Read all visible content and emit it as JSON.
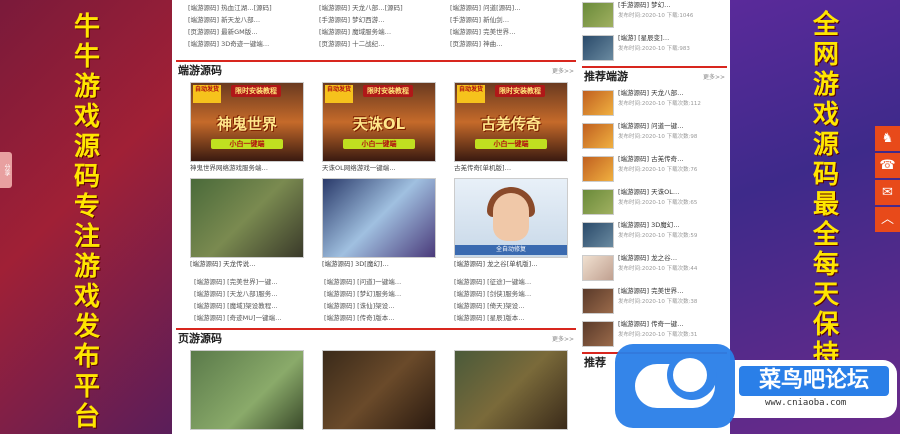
{
  "left_banner": {
    "text": [
      "牛",
      "牛",
      "游",
      "戏",
      "源",
      "码",
      "专",
      "注",
      "游",
      "戏",
      "发",
      "布",
      "平",
      "台"
    ]
  },
  "right_banner": {
    "text": [
      "全",
      "网",
      "游",
      "戏",
      "源",
      "码",
      "最",
      "全",
      "每",
      "天",
      "保",
      "持"
    ]
  },
  "side_tab": {
    "label": "分享"
  },
  "top_news": {
    "col1": [
      "[端游源码] 热血江湖…[源码]",
      "[端游源码] 新天龙八部…",
      "[页游源码] 最新GM版…",
      "[端游源码] 3D奇迹一键端…"
    ],
    "col2": [
      "[端游源码] 天龙八部…[源码]",
      "[手游源码] 梦幻西游…",
      "[端游源码] 魔域服务端…",
      "[页游源码] 十二战纪…"
    ],
    "col3": [
      "[端游源码] 问道[源码]…",
      "[手游源码] 新仙剑…",
      "[端游源码] 完美世界…",
      "[页游源码] 神曲…"
    ]
  },
  "section_duanyou": {
    "title": "端游源码",
    "more": "更多>>",
    "promo_top": "限时安装教程",
    "promo_badge": "自动发货",
    "cards": [
      {
        "type": "promo",
        "big": "神鬼世界",
        "sub": "小白一键端",
        "caption": "神鬼世界网络游戏服务端…"
      },
      {
        "type": "promo",
        "big": "天诛OL",
        "sub": "小白一键端",
        "caption": "天诛OL网络游戏一键端…"
      },
      {
        "type": "promo",
        "big": "古羌传奇",
        "sub": "小白一键端",
        "caption": "古羌传奇[单机版]…"
      },
      {
        "type": "game1",
        "caption": "[端游源码] 天龙传说…"
      },
      {
        "type": "game2",
        "caption": "[端游源码] 3D[魔幻]…"
      },
      {
        "type": "game3",
        "bar": "全自动修复",
        "caption": "[端游源码] 龙之谷[单机版]…"
      }
    ],
    "list": {
      "col1": [
        "[端游源码] [完美世界]一键…",
        "[端游源码] [天龙八部]服务…",
        "[端游源码] [魔域]架设教程…",
        "[端游源码] [奇迹MU]一键端…"
      ],
      "col2": [
        "[端游源码] [问道]一键端…",
        "[端游源码] [梦幻]服务端…",
        "[端游源码] [诛仙]架设…",
        "[端游源码] [传奇]版本…"
      ],
      "col3": [
        "[端游源码] [征途]一键端…",
        "[端游源码] [剑侠]服务端…",
        "[端游源码] [倚天]架设…",
        "[端游源码] [星辰]版本…"
      ]
    }
  },
  "section_yeyou": {
    "title": "页游源码",
    "more": "更多>>",
    "cards": [
      {
        "type": "game4"
      },
      {
        "type": "game5"
      },
      {
        "type": "game6"
      }
    ]
  },
  "sidebar_top": [
    {
      "name": "[手游源码] 梦幻…",
      "meta": "发布时间:2020-10 下载:1046"
    },
    {
      "name": "[端游] [星辰变]…",
      "meta": "发布时间:2020-10 下载:983"
    }
  ],
  "sidebar_recommend": {
    "title": "推荐端游",
    "more": "更多>>",
    "items": [
      {
        "name": "[端游源码] 天龙八部…",
        "meta": "发布时间:2020-10 下载次数:112"
      },
      {
        "name": "[端游源码] 问道一键…",
        "meta": "发布时间:2020-10 下载次数:98"
      },
      {
        "name": "[端游源码] 古羌传奇…",
        "meta": "发布时间:2020-10 下载次数:76"
      },
      {
        "name": "[端游源码] 天诛OL…",
        "meta": "发布时间:2020-10 下载次数:65"
      },
      {
        "name": "[端游源码] 3D魔幻…",
        "meta": "发布时间:2020-10 下载次数:59"
      },
      {
        "name": "[端游源码] 龙之谷…",
        "meta": "发布时间:2020-10 下载次数:44"
      },
      {
        "name": "[端游源码] 完美世界…",
        "meta": "发布时间:2020-10 下载次数:38"
      },
      {
        "name": "[端游源码] 传奇一键…",
        "meta": "发布时间:2020-10 下载次数:31"
      }
    ]
  },
  "sidebar_bottom": {
    "title": "推荐"
  },
  "tools": {
    "qq": "♞",
    "phone": "☎",
    "chat": "✉",
    "top": "︿"
  },
  "watermark": {
    "title": "菜鸟吧论坛",
    "url": "www.cniaoba.com"
  }
}
